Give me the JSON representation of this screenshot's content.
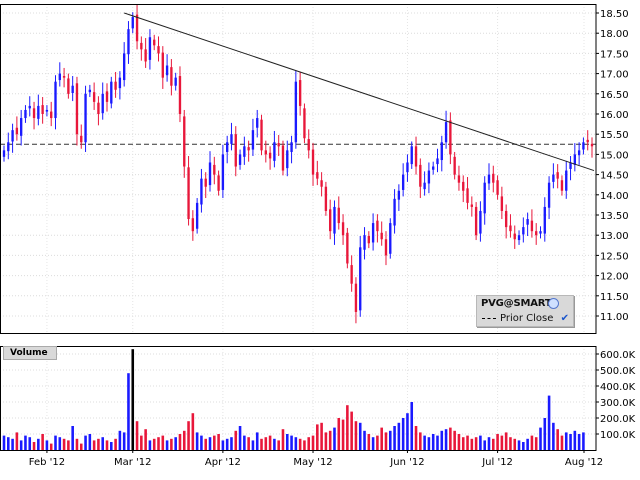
{
  "chart_data": [
    {
      "type": "candlestick",
      "symbol": "PVG@SMART",
      "legend": [
        "PVG@SMART",
        "Prior Close"
      ],
      "y_ticks": [
        "18.50",
        "18.00",
        "17.50",
        "17.00",
        "16.50",
        "16.00",
        "15.50",
        "15.00",
        "14.50",
        "14.00",
        "13.50",
        "13.00",
        "12.50",
        "12.00",
        "11.50",
        "11.00"
      ],
      "ylim": [
        10.75,
        18.65
      ],
      "prior_close": 15.25,
      "x_ticks": [
        "Feb '12",
        "Mar '12",
        "Apr '12",
        "May '12",
        "Jun '12",
        "Jul '12",
        "Aug '12"
      ],
      "trendline": {
        "start_close": 18.5,
        "end_close": 14.6
      },
      "closes": [
        15.1,
        15.3,
        15.6,
        15.5,
        15.9,
        16.1,
        16.2,
        15.9,
        16.2,
        16.0,
        16.1,
        15.9,
        16.8,
        17.0,
        16.9,
        16.5,
        16.7,
        15.5,
        15.3,
        16.5,
        16.6,
        16.3,
        16.0,
        16.5,
        16.3,
        16.8,
        16.6,
        16.9,
        17.5,
        18.1,
        18.4,
        17.8,
        17.6,
        17.3,
        17.9,
        17.7,
        17.5,
        16.9,
        17.2,
        16.7,
        16.9,
        16.0,
        14.7,
        13.4,
        13.1,
        13.8,
        14.4,
        14.2,
        14.8,
        14.5,
        14.1,
        15.0,
        15.3,
        15.5,
        14.7,
        15.0,
        15.2,
        15.1,
        15.6,
        15.9,
        15.1,
        15.0,
        14.9,
        15.3,
        15.2,
        14.6,
        15.1,
        15.3,
        16.8,
        16.2,
        15.4,
        15.1,
        14.5,
        14.4,
        14.2,
        13.6,
        13.1,
        13.7,
        13.3,
        13.0,
        12.3,
        11.8,
        11.1,
        12.7,
        13.0,
        12.8,
        13.3,
        13.1,
        12.9,
        12.5,
        13.3,
        13.9,
        14.1,
        14.5,
        14.8,
        15.2,
        14.7,
        14.2,
        14.3,
        14.6,
        14.7,
        14.9,
        15.3,
        15.8,
        15.0,
        14.5,
        14.3,
        14.1,
        13.8,
        13.7,
        13.0,
        13.6,
        14.3,
        14.5,
        14.3,
        14.0,
        13.6,
        13.2,
        13.1,
        12.9,
        13.0,
        13.2,
        13.4,
        13.1,
        13.0,
        13.1,
        13.7,
        14.3,
        14.5,
        14.4,
        14.1,
        14.6,
        14.8,
        15.0,
        15.1,
        15.3,
        15.3,
        15.2
      ],
      "volume_ticks": [
        "600.0K",
        "500.0K",
        "400.0K",
        "300.0K",
        "200.0K",
        "100.0K"
      ],
      "volume_label": "Volume",
      "volumes": [
        90,
        80,
        70,
        110,
        60,
        90,
        80,
        50,
        70,
        100,
        60,
        40,
        90,
        80,
        70,
        60,
        150,
        70,
        40,
        90,
        100,
        60,
        70,
        80,
        60,
        50,
        70,
        120,
        110,
        480,
        630,
        180,
        90,
        130,
        60,
        70,
        80,
        90,
        60,
        70,
        80,
        100,
        120,
        180,
        230,
        110,
        90,
        70,
        80,
        90,
        100,
        60,
        70,
        80,
        120,
        150,
        90,
        80,
        60,
        110,
        70,
        80,
        90,
        70,
        60,
        130,
        100,
        90,
        80,
        70,
        60,
        80,
        90,
        160,
        170,
        110,
        120,
        140,
        200,
        190,
        280,
        240,
        180,
        170,
        120,
        100,
        80,
        90,
        140,
        110,
        120,
        150,
        170,
        200,
        230,
        300,
        150,
        110,
        90,
        80,
        100,
        90,
        120,
        130,
        140,
        120,
        100,
        80,
        90,
        70,
        80,
        90,
        60,
        80,
        70,
        100,
        90,
        110,
        80,
        70,
        60,
        50,
        70,
        90,
        80,
        140,
        200,
        340,
        170,
        130,
        90,
        110,
        100,
        120,
        100,
        110
      ]
    }
  ]
}
